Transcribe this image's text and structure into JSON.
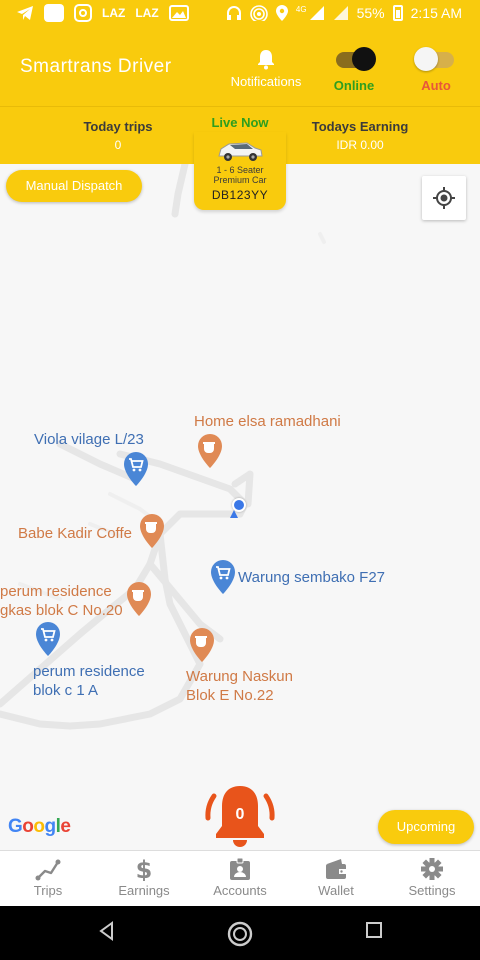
{
  "status_bar": {
    "left_labels": [
      "LAZ",
      "LAZ"
    ],
    "network": "4G",
    "battery": "55%",
    "time": "2:15 AM"
  },
  "header": {
    "app_title": "Smartrans Driver",
    "notifications_label": "Notifications",
    "online_label": "Online",
    "auto_label": "Auto",
    "online_state": true,
    "auto_state": false
  },
  "stats": {
    "today_trips_label": "Today trips",
    "today_trips_value": "0",
    "live_now_label": "Live Now",
    "todays_earning_label": "Todays Earning",
    "todays_earning_value": "IDR 0.00"
  },
  "vehicle": {
    "seat_label": "1 - 6 Seater",
    "car_type": "Premium Car",
    "plate": "DB123YY"
  },
  "map": {
    "manual_dispatch_label": "Manual Dispatch",
    "google_logo": "Google",
    "upcoming_label": "Upcoming",
    "alarm_count": "0",
    "pois": [
      {
        "name": "Home elsa ramadhani",
        "type": "cafe"
      },
      {
        "name": "Viola vilage L/23",
        "type": "shop"
      },
      {
        "name": "Babe Kadir Coffe",
        "type": "cafe"
      },
      {
        "name": "Warung sembako F27",
        "type": "shop"
      },
      {
        "name": "perum residence\ngkas blok C No.20",
        "type": "cafe"
      },
      {
        "name": "perum residence\nblok c 1 A",
        "type": "shop"
      },
      {
        "name": "Warung Naskun\nBlok E No.22",
        "type": "cafe"
      }
    ]
  },
  "bottom_nav": [
    {
      "label": "Trips",
      "icon": "trips-icon"
    },
    {
      "label": "Earnings",
      "icon": "dollar-icon"
    },
    {
      "label": "Accounts",
      "icon": "badge-icon"
    },
    {
      "label": "Wallet",
      "icon": "wallet-icon"
    },
    {
      "label": "Settings",
      "icon": "gear-icon"
    }
  ],
  "colors": {
    "brand_yellow": "#f9cb0d",
    "online_green": "#2e9e1f",
    "auto_red": "#e8563a",
    "alarm_orange": "#e8541b",
    "poi_blue": "#3f6fb3",
    "poi_orange": "#d07a46"
  }
}
